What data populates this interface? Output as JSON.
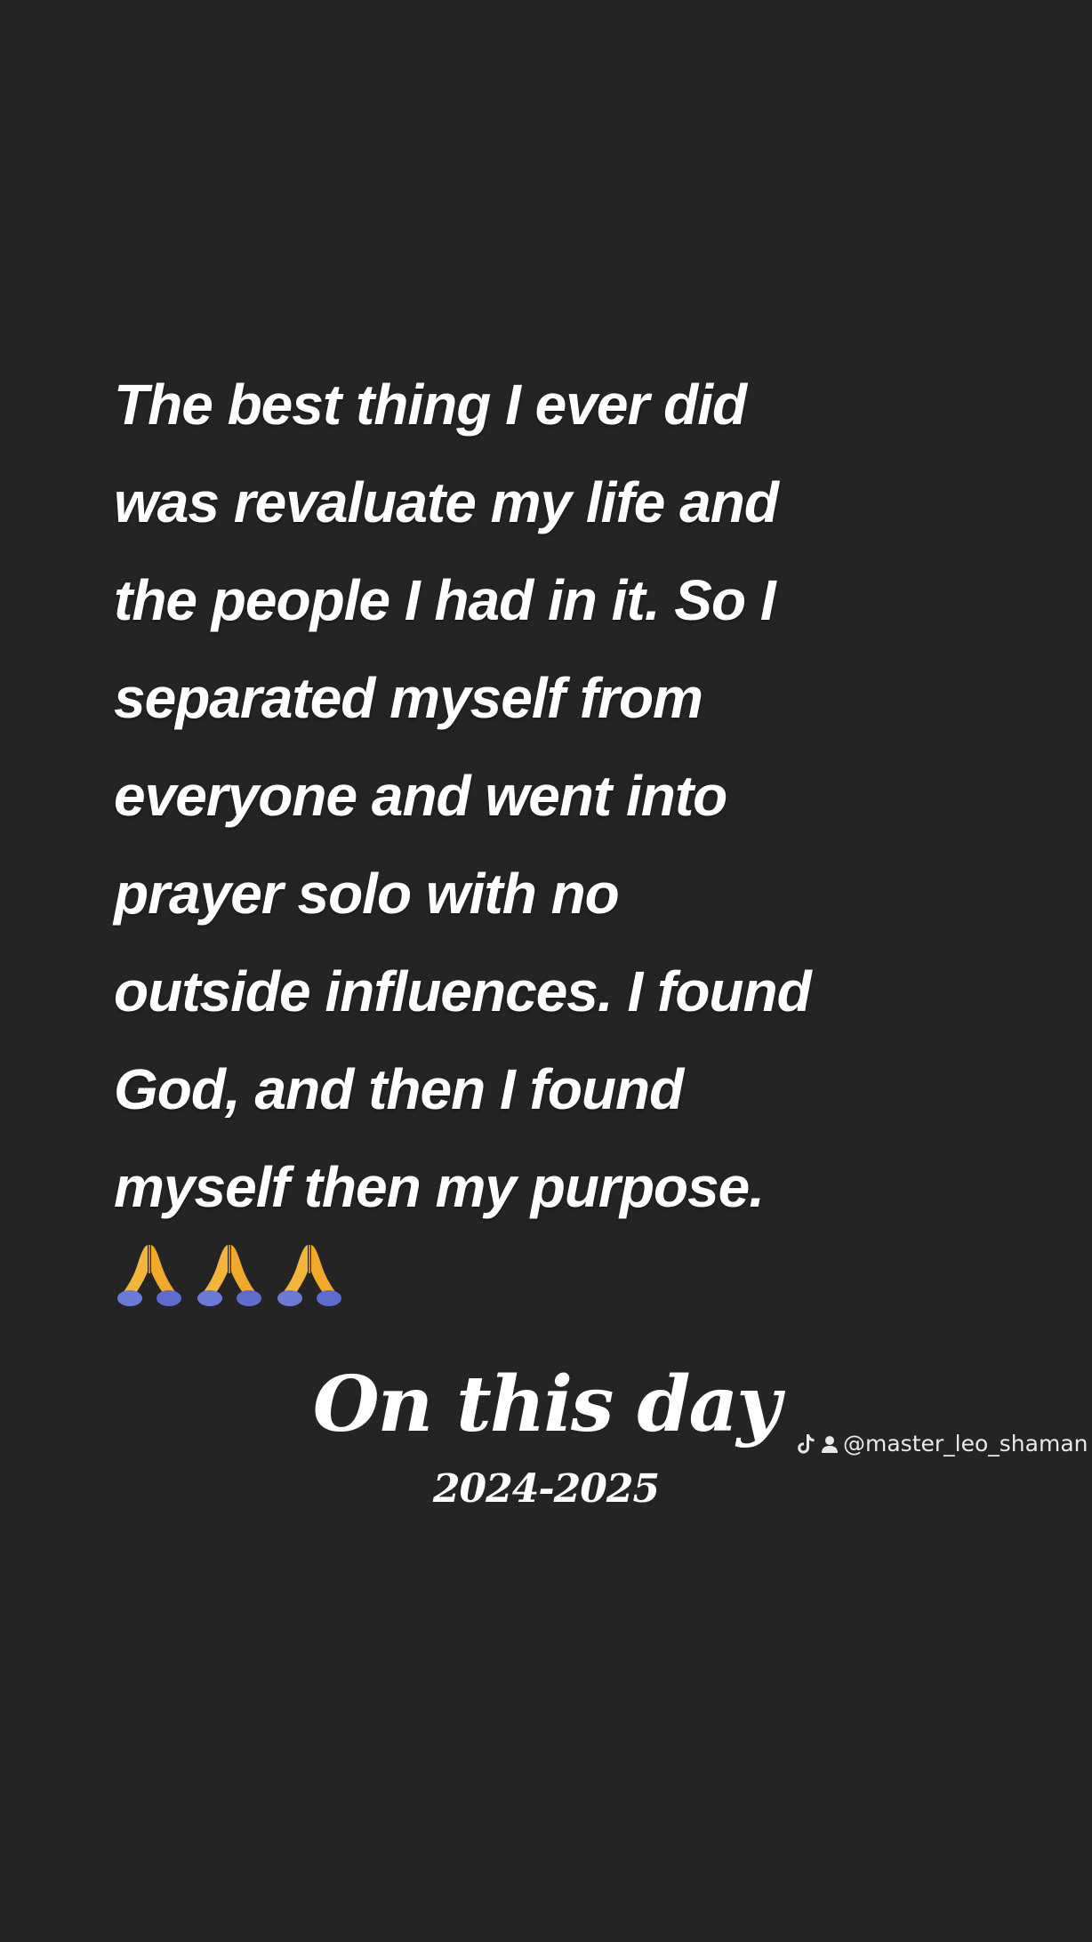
{
  "quote": {
    "lines": [
      "The best thing I ever did",
      "was revaluate my life and",
      "the people I had in it. So I",
      "separated myself from",
      "everyone and went into",
      "prayer solo with no",
      "outside influences. I found",
      "God, and then I found",
      "myself then my purpose."
    ],
    "emoji": [
      "praying-hands-icon",
      "praying-hands-icon",
      "praying-hands-icon"
    ]
  },
  "memory": {
    "title": "On this day",
    "years": "2024-2025"
  },
  "watermark": {
    "icons": [
      "tiktok-icon",
      "user-icon"
    ],
    "handle": "@master_leo_shaman"
  },
  "colors": {
    "background": "#242424",
    "text": "#ffffff",
    "emoji_skin": "#f3b63a",
    "emoji_sleeve": "#6b79d8"
  }
}
